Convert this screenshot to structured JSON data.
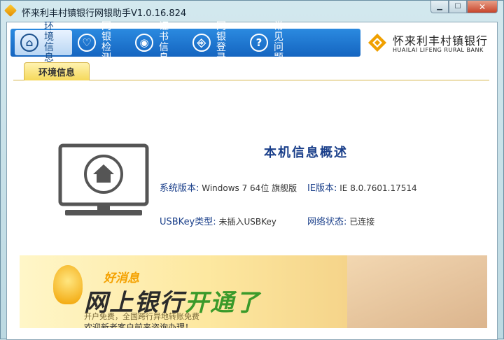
{
  "window": {
    "title": "怀来利丰村镇银行网银助手V1.0.16.824"
  },
  "winbuttons": {
    "minimize": "▁",
    "maximize": "☐",
    "close": "✕"
  },
  "nav": [
    {
      "label": "环境信息",
      "icon": "home-icon",
      "glyph": "⌂"
    },
    {
      "label": "网银检测",
      "icon": "stethoscope-icon",
      "glyph": "♡"
    },
    {
      "label": "证书信息",
      "icon": "certificate-icon",
      "glyph": "◉"
    },
    {
      "label": "网银登录",
      "icon": "login-icon",
      "glyph": "⎆"
    },
    {
      "label": "常见问题",
      "icon": "question-icon",
      "glyph": "?"
    }
  ],
  "bank": {
    "name": "怀来利丰村镇银行",
    "name_en": "HUAILAI LIFENG RURAL BANK"
  },
  "tab": {
    "label": "环境信息"
  },
  "overview": {
    "title": "本机信息概述",
    "os_key": "系统版本:",
    "os_val": "Windows 7 64位 旗舰版",
    "ie_key": "IE版本:",
    "ie_val": "IE 8.0.7601.17514",
    "usbkey_key": "USBKey类型:",
    "usbkey_val": "未插入USBKey",
    "net_key": "网络状态:",
    "net_val": "已连接"
  },
  "banner": {
    "good_news": "好消息",
    "main_a": "网上银行",
    "main_b": "开通了",
    "sub": "开户免费，全国跨行异地转账免费",
    "sub2": "欢迎新老客户前来咨询办理！"
  },
  "colors": {
    "nav_blue": "#1e78d4",
    "title_blue": "#1a3f8a",
    "tab_yellow": "#f5d85a"
  }
}
